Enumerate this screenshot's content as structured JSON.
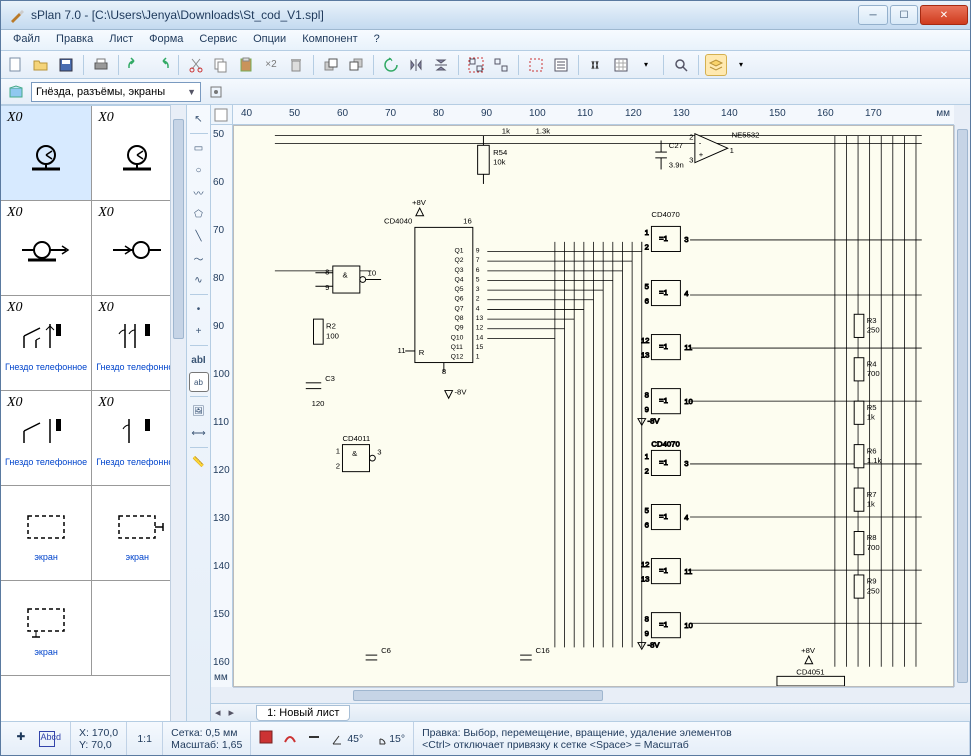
{
  "window": {
    "title": "sPlan 7.0 - [C:\\Users\\Jenya\\Downloads\\St_cod_V1.spl]"
  },
  "menu": [
    "Файл",
    "Правка",
    "Лист",
    "Форма",
    "Сервис",
    "Опции",
    "Компонент",
    "?"
  ],
  "library_combo": "Гнёзда, разъёмы, экраны",
  "library_items": [
    {
      "ref": "X0",
      "caption": ""
    },
    {
      "ref": "X0",
      "caption": ""
    },
    {
      "ref": "X0",
      "caption": ""
    },
    {
      "ref": "X0",
      "caption": ""
    },
    {
      "ref": "X0",
      "caption": "Гнездо телефонное"
    },
    {
      "ref": "X0",
      "caption": "Гнездо телефонное"
    },
    {
      "ref": "X0",
      "caption": "Гнездо телефонное"
    },
    {
      "ref": "X0",
      "caption": "Гнездо телефонное"
    },
    {
      "ref": "",
      "caption": "экран"
    },
    {
      "ref": "",
      "caption": "экран"
    },
    {
      "ref": "",
      "caption": "экран"
    },
    {
      "ref": "",
      "caption": ""
    }
  ],
  "ruler": {
    "top": [
      "40",
      "50",
      "60",
      "70",
      "80",
      "90",
      "100",
      "110",
      "120",
      "130",
      "140",
      "150",
      "160",
      "170"
    ],
    "left": [
      "50",
      "60",
      "70",
      "80",
      "90",
      "100",
      "110",
      "120",
      "130",
      "140",
      "150",
      "160"
    ],
    "unit": "мм"
  },
  "sheet_tab": "1: Новый лист",
  "schematic": {
    "vplus": "+8V",
    "vminus": "-8V",
    "parts": {
      "ic1": {
        "ref": "CD4040",
        "pin_vcc": "16",
        "pin_in": "11",
        "pin_r": "R",
        "pin_gnd": "8",
        "q": [
          "Q1",
          "Q2",
          "Q3",
          "Q4",
          "Q5",
          "Q6",
          "Q7",
          "Q8",
          "Q9",
          "Q10",
          "Q11",
          "Q12"
        ],
        "qn": [
          "9",
          "7",
          "6",
          "5",
          "3",
          "2",
          "4",
          "13",
          "12",
          "14",
          "15",
          "1"
        ]
      },
      "ic2": {
        "ref": "CD4011",
        "gate_sym": "&",
        "p1": "1",
        "p2": "2",
        "p3": "3"
      },
      "ic3": {
        "ref": "CD4051"
      },
      "opamp": {
        "ref": "NE5532",
        "pminus": "-",
        "pplus": "+",
        "pin1": "1",
        "pin2": "2",
        "pin3": "3"
      },
      "xor_a": {
        "ref": "CD4070",
        "sym": "=1"
      },
      "xor_b": {
        "ref": "CD4070",
        "sym": "=1"
      },
      "and1": {
        "sym": "&",
        "p8": "8",
        "p9": "9",
        "p10": "10"
      },
      "r2": {
        "ref": "R2",
        "val": "100"
      },
      "r3": {
        "ref": "R3",
        "val": "250"
      },
      "r4": {
        "ref": "R4",
        "val": "700"
      },
      "r5": {
        "ref": "R5",
        "val": "1k"
      },
      "r6": {
        "ref": "R6",
        "val": "1.1k"
      },
      "r7": {
        "ref": "R7",
        "val": "1k"
      },
      "r8": {
        "ref": "R8",
        "val": "700"
      },
      "r9": {
        "ref": "R9",
        "val": "250"
      },
      "r54": {
        "ref": "R54",
        "val": "10k"
      },
      "c3": {
        "ref": "C3",
        "val": "120"
      },
      "c6": {
        "ref": "C6"
      },
      "c16": {
        "ref": "C16"
      },
      "c27": {
        "ref": "C27",
        "val": "3.9n"
      },
      "top_r1": "1k",
      "top_r2": "1.3k",
      "xor_pins": {
        "a": {
          "p1": "1",
          "p2": "2",
          "p3": "3"
        },
        "b": {
          "p5": "5",
          "p6": "6",
          "p4": "4"
        },
        "c": {
          "p12": "12",
          "p13": "13",
          "p11": "11"
        },
        "d": {
          "p8": "8",
          "p9": "9",
          "p10": "10"
        }
      }
    }
  },
  "status": {
    "coords": {
      "x": "X: 170,0",
      "y": "Y: 70,0"
    },
    "ratio": "1:1",
    "grid": "Сетка: 0,5 мм",
    "scale": "Масштаб:  1,65",
    "angle1": "45°",
    "angle2": "15°",
    "mode_line1": "Правка: Выбор, перемещение, вращение, удаление элементов",
    "mode_line2": "<Ctrl> отключает привязку к сетке <Space> = Масштаб"
  }
}
